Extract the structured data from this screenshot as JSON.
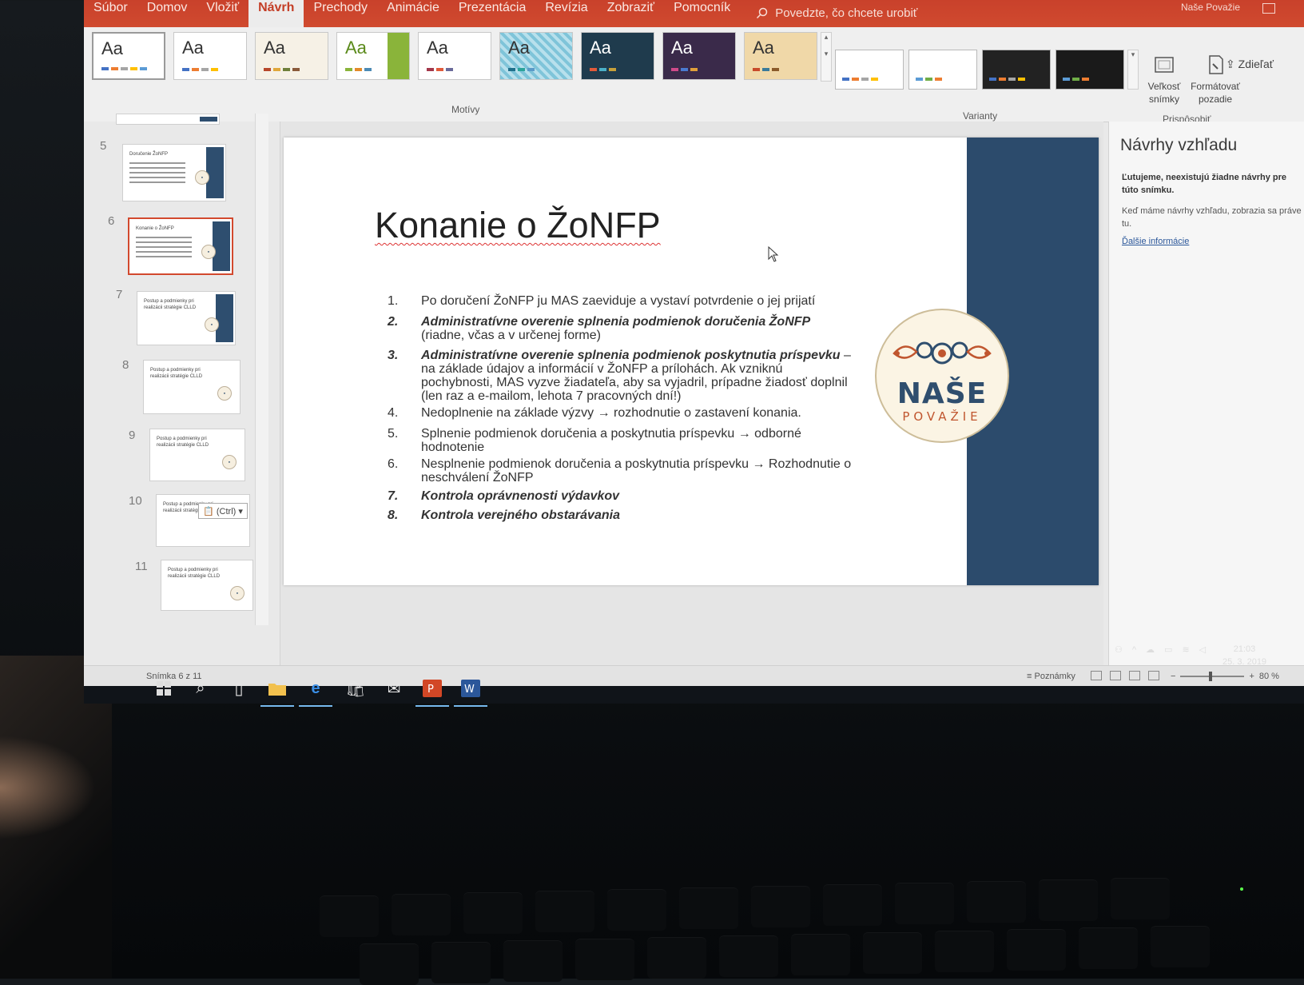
{
  "ribbon": {
    "tabs": [
      "Súbor",
      "Domov",
      "Vložiť",
      "Návrh",
      "Prechody",
      "Animácie",
      "Prezentácia",
      "Revízia",
      "Zobraziť",
      "Pomocník"
    ],
    "active_tab": "Návrh",
    "tell_me": "Povedzte, čo chcete urobiť",
    "owner": "Naše Považie",
    "share": "Zdieľať",
    "themes_group": "Motívy",
    "variants_group": "Varianty",
    "customize_group": "Prispôsobiť",
    "theme_sample": "Aa",
    "slide_size": "Veľkosť snímky",
    "format_background": "Formátovať pozadie"
  },
  "thumbnails": {
    "items": [
      {
        "num": "5",
        "title": "Doručenie ŽoNFP"
      },
      {
        "num": "6",
        "title": "Konanie o ŽoNFP"
      },
      {
        "num": "7",
        "title": "Postup a podmienky pri realizácii stratégie CLLD"
      },
      {
        "num": "8",
        "title": "Postup a podmienky pri realizácii stratégie CLLD"
      },
      {
        "num": "9",
        "title": "Postup a podmienky pri realizácii stratégie CLLD"
      },
      {
        "num": "10",
        "title": "Postup a podmienky pri realizácii stratégie CLLD"
      },
      {
        "num": "11",
        "title": "Postup a podmienky pri realizácii stratégie CLLD"
      }
    ],
    "selected": "6",
    "paste_badge": "(Ctrl)"
  },
  "slide": {
    "title": "Konanie o ŽoNFP",
    "items": [
      {
        "num": "1.",
        "text": "Po doručení ŽoNFP ju MAS zaeviduje a vystaví potvrdenie o jej prijatí"
      },
      {
        "num": "2.",
        "bold": "Administratívne overenie splnenia podmienok doručenia ŽoNFP",
        "text": " (riadne, včas a v určenej forme)"
      },
      {
        "num": "3.",
        "bold": "Administratívne overenie splnenia podmienok poskytnutia príspevku",
        "text": " – na základe údajov a informácií v ŽoNFP a prílohách. Ak vzniknú pochybnosti, MAS vyzve žiadateľa, aby sa vyjadril, prípadne žiadosť doplnil (len raz a e-mailom, lehota 7 pracovných dní!)"
      },
      {
        "num": "4.",
        "text": "Nedoplnenie na základe výzvy → rozhodnutie o zastavení konania."
      },
      {
        "num": "5.",
        "text": "Splnenie podmienok doručenia a poskytnutia príspevku → odborné hodnotenie"
      },
      {
        "num": "6.",
        "text": "Nesplnenie podmienok doručenia a poskytnutia príspevku → Rozhodnutie o neschválení ŽoNFP"
      },
      {
        "num": "7.",
        "bold": "Kontrola oprávnenosti výdavkov",
        "text": ""
      },
      {
        "num": "8.",
        "bold": "Kontrola verejného obstarávania",
        "text": ""
      }
    ],
    "logo_main": "NAŠE",
    "logo_sub": "POVAŽIE"
  },
  "design_pane": {
    "title": "Návrhy vzhľadu",
    "message": "Ľutujeme, neexistujú žiadne návrhy pre túto snímku.",
    "note": "Keď máme návrhy vzhľadu, zobrazia sa práve tu.",
    "link": "Ďalšie informácie"
  },
  "status": {
    "slide_counter": "Snímka 6 z 11",
    "notes": "Poznámky",
    "zoom": "80 %"
  },
  "taskbar": {
    "time": "21:03",
    "date": "25. 3. 2019"
  },
  "colors": {
    "accent": "#c9412b",
    "slide_panel": "#2c4b6c",
    "logo_text": "#2f4e6e",
    "logo_sub": "#c0562f"
  }
}
